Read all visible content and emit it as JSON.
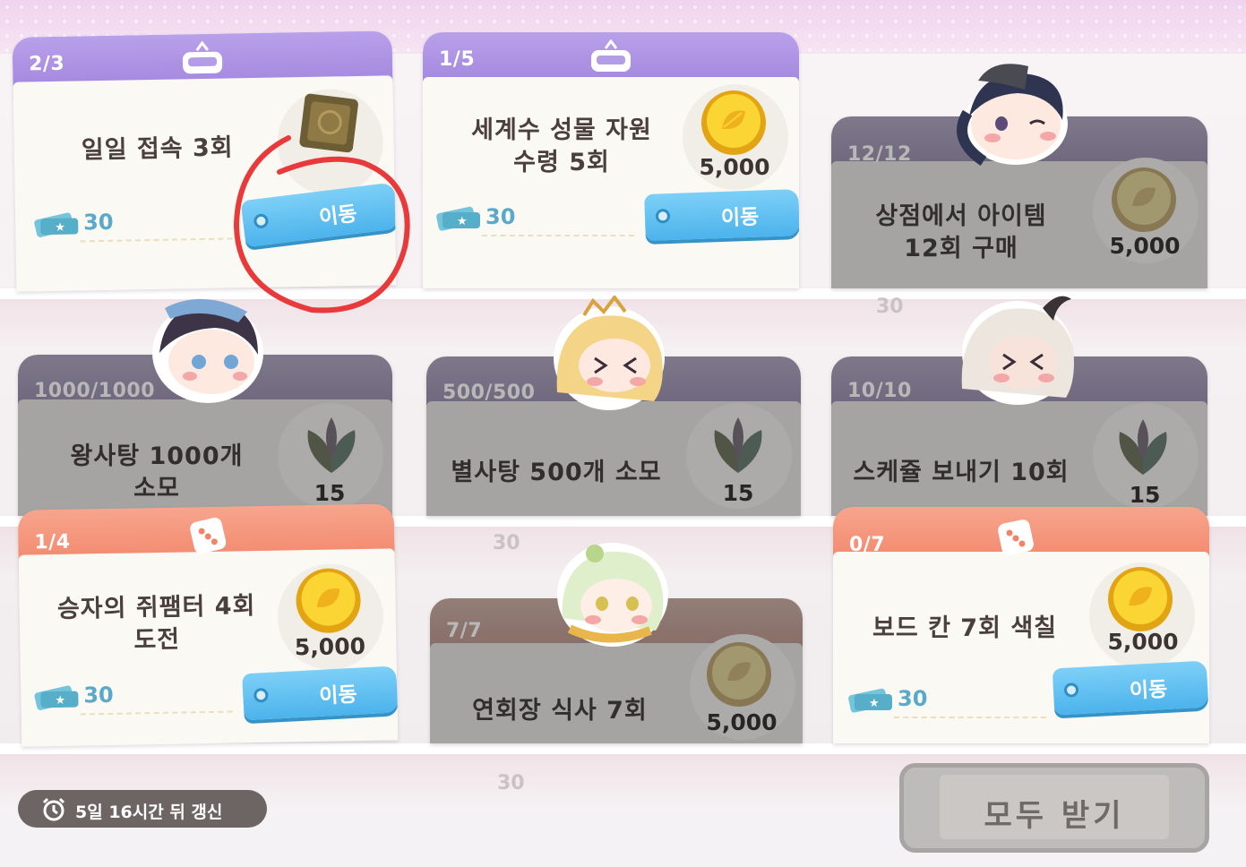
{
  "colors": {
    "purple_header": "#a98ee2",
    "orange_header": "#f39276",
    "move_button": "#5bbdf0",
    "ticket": "#5aa9c9",
    "annotation_circle": "#e83a3a"
  },
  "missions": [
    {
      "progress": "2/3",
      "title": "일일 접속 3회",
      "reward": "",
      "reward_icon": "tile-box-icon",
      "tickets": "30",
      "button": "이동",
      "head_icon": "gift-box-icon"
    },
    {
      "progress": "1/5",
      "title_line1": "세계수 성물 자원",
      "title_line2": "수령 5회",
      "reward": "5,000",
      "reward_icon": "gold-coin-icon",
      "tickets": "30",
      "button": "이동",
      "head_icon": "gift-box-icon"
    },
    {
      "progress": "12/12",
      "title_line1": "상점에서 아이템",
      "title_line2": "12회 구매",
      "reward": "5,000",
      "reward_icon": "gold-coin-icon",
      "state": "completed"
    },
    {
      "progress": "1000/1000",
      "title_line1": "왕사탕 1000개",
      "title_line2": "소모",
      "reward": "15",
      "reward_icon": "leaf-crystal-icon",
      "state": "completed"
    },
    {
      "progress": "500/500",
      "title": "별사탕 500개 소모",
      "reward": "15",
      "reward_icon": "leaf-crystal-icon",
      "state": "completed"
    },
    {
      "progress": "10/10",
      "title": "스케쥴 보내기 10회",
      "reward": "15",
      "reward_icon": "leaf-crystal-icon",
      "state": "completed"
    },
    {
      "progress": "1/4",
      "title_line1": "승자의 쥐팸터 4회",
      "title_line2": "도전",
      "reward": "5,000",
      "reward_icon": "gold-coin-icon",
      "tickets": "30",
      "button": "이동",
      "head_icon": "dice-icon"
    },
    {
      "progress": "7/7",
      "title": "연회장 식사 7회",
      "reward": "5,000",
      "reward_icon": "gold-coin-icon",
      "state": "completed"
    },
    {
      "progress": "0/7",
      "title": "보드 칸 7회 색칠",
      "reward": "5,000",
      "reward_icon": "gold-coin-icon",
      "tickets": "30",
      "button": "이동",
      "head_icon": "dice-icon"
    }
  ],
  "reflections": {
    "ticket": "30"
  },
  "footer": {
    "refresh_text": "5일 16시간 뒤 갱신",
    "claim_all": "모두 받기"
  }
}
